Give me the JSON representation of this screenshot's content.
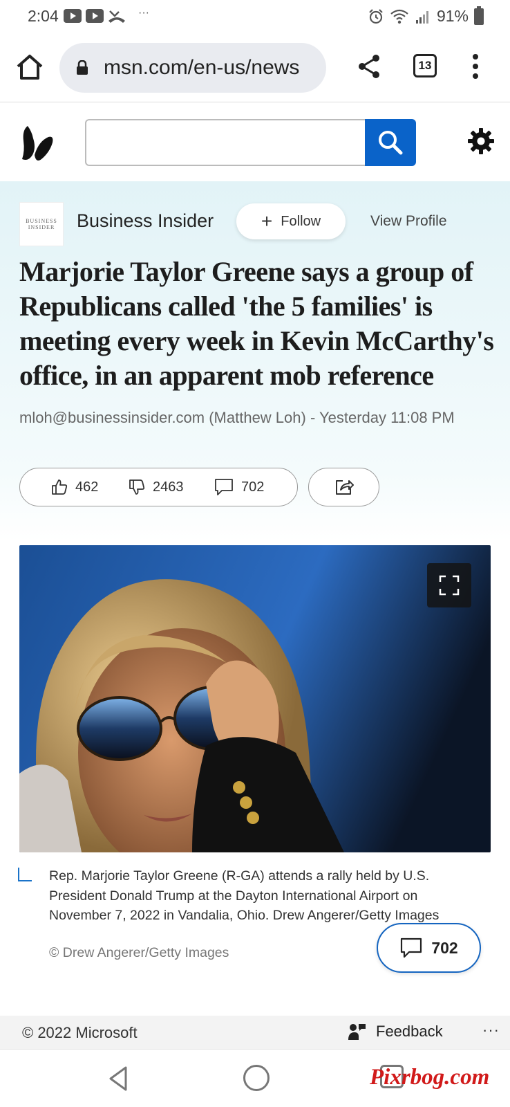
{
  "status_bar": {
    "time": "2:04",
    "more": "···",
    "battery": "91%"
  },
  "browser": {
    "url": "msn.com/en-us/news",
    "tab_count": "13"
  },
  "msn": {
    "search_placeholder": ""
  },
  "article": {
    "publisher": {
      "logo_line1": "BUSINESS",
      "logo_line2": "INSIDER",
      "name": "Business Insider",
      "follow_label": "Follow",
      "view_profile_label": "View Profile"
    },
    "headline": "Marjorie Taylor Greene says a group of Republicans called 'the 5 families' is meeting every week in Kevin McCarthy's office, in an apparent mob reference",
    "byline": "mloh@businessinsider.com (Matthew Loh) - Yesterday 11:08 PM",
    "likes": "462",
    "dislikes": "2463",
    "comments": "702",
    "caption": "Rep. Marjorie Taylor Greene (R-GA) attends a rally held by U.S. President Donald Trump at the Dayton International Airport on November 7, 2022 in Vandalia, Ohio. Drew Angerer/Getty Images",
    "credit": "© Drew Angerer/Getty Images",
    "comment_fab_count": "702"
  },
  "footer": {
    "copyright": "© 2022 Microsoft",
    "feedback_label": "Feedback",
    "more": "···"
  },
  "watermark": "Pixrbog.com",
  "colors": {
    "accent": "#0a63c9",
    "fab_border": "#1565c0",
    "watermark": "#d11a1a"
  }
}
